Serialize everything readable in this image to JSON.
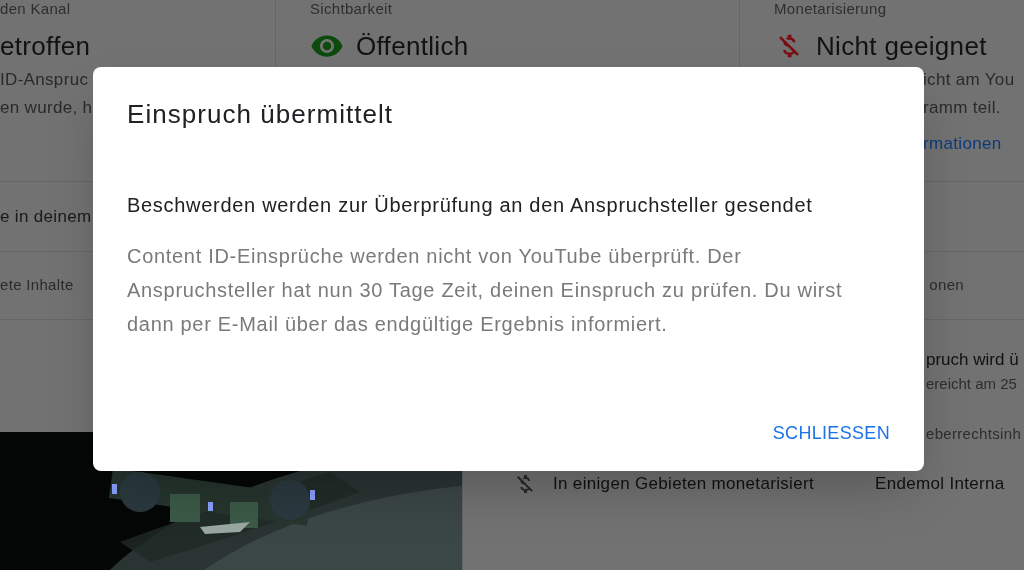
{
  "summary": [
    {
      "kind": "status",
      "label": "den Kanal",
      "value": "etroffen",
      "lines": [
        "ID-Anspruc",
        "en wurde, h"
      ]
    },
    {
      "kind": "visibility",
      "label": "Sichtbarkeit",
      "value": "Öffentlich"
    },
    {
      "kind": "monetization",
      "label": "Monetarisierung",
      "value": "Nicht geeignet",
      "lines": [
        "icht am You",
        "ramm teil."
      ],
      "link": "rmationen"
    }
  ],
  "notice": "e in deinem",
  "column_headers": [
    "ete Inhalte",
    "onen"
  ],
  "claim": {
    "title": "pruch wird ü",
    "subtitle": "ereicht am 25",
    "owner_label": "eberrechtsinh",
    "monetization": "In einigen Gebieten monetarisiert",
    "owner": "Endemol Interna"
  },
  "dialog": {
    "title": "Einspruch übermittelt",
    "heading": "Beschwerden werden zur Überprüfung an den Anspruchsteller gesendet",
    "body": "Content ID-Einsprüche werden nicht von YouTube überprüft. Der Anspruchsteller hat nun 30 Tage Zeit, deinen Einspruch zu prüfen. Du wirst dann per E-Mail über das endgültige Ergebnis informiert.",
    "buttons": [
      "SCHLIESSEN"
    ]
  }
}
